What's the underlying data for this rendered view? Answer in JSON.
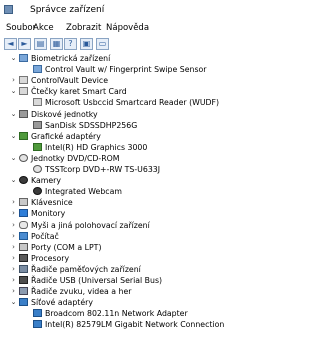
{
  "window": {
    "title": "Správce zařízení"
  },
  "menu": [
    "Soubor",
    "Akce",
    "Zobrazit",
    "Nápověda"
  ],
  "toolbar": [
    {
      "name": "back-button",
      "glyph": "◄"
    },
    {
      "name": "forward-button",
      "glyph": "►"
    },
    {
      "name": "view-tree-button",
      "glyph": "▤"
    },
    {
      "name": "properties-button",
      "glyph": "▦"
    },
    {
      "name": "help-button",
      "glyph": "?"
    },
    {
      "name": "update-driver-button",
      "glyph": "▣"
    },
    {
      "name": "show-display-button",
      "glyph": "▭"
    }
  ],
  "tree": [
    {
      "label": "Biometrická zařízení",
      "level": 0,
      "expanded": true,
      "icon": "dev"
    },
    {
      "label": "Control Vault w/ Fingerprint Swipe Sensor",
      "level": 1,
      "icon": "dev"
    },
    {
      "label": "ControlVault Device",
      "level": 0,
      "expanded": false,
      "icon": "card"
    },
    {
      "label": "Čtečky karet Smart Card",
      "level": 0,
      "expanded": true,
      "icon": "card"
    },
    {
      "label": "Microsoft Usbccid Smartcard Reader (WUDF)",
      "level": 1,
      "icon": "card"
    },
    {
      "label": "Diskové jednotky",
      "level": 0,
      "expanded": true,
      "icon": "disk"
    },
    {
      "label": "SanDisk SDSSDHP256G",
      "level": 1,
      "icon": "disk"
    },
    {
      "label": "Grafické adaptéry",
      "level": 0,
      "expanded": true,
      "icon": "gpu"
    },
    {
      "label": "Intel(R) HD Graphics 3000",
      "level": 1,
      "icon": "gpu"
    },
    {
      "label": "Jednotky DVD/CD-ROM",
      "level": 0,
      "expanded": true,
      "icon": "dvd"
    },
    {
      "label": "TSSTcorp DVD+-RW TS-U633J",
      "level": 1,
      "icon": "dvd"
    },
    {
      "label": "Kamery",
      "level": 0,
      "expanded": true,
      "icon": "cam"
    },
    {
      "label": "Integrated Webcam",
      "level": 1,
      "icon": "cam"
    },
    {
      "label": "Klávesnice",
      "level": 0,
      "expanded": false,
      "icon": "kbd"
    },
    {
      "label": "Monitory",
      "level": 0,
      "expanded": false,
      "icon": "mon"
    },
    {
      "label": "Myši a jiná polohovací zařízení",
      "level": 0,
      "expanded": false,
      "icon": "mouse"
    },
    {
      "label": "Počítač",
      "level": 0,
      "expanded": false,
      "icon": "pc"
    },
    {
      "label": "Porty (COM a LPT)",
      "level": 0,
      "expanded": false,
      "icon": "port"
    },
    {
      "label": "Procesory",
      "level": 0,
      "expanded": false,
      "icon": "cpu"
    },
    {
      "label": "Řadiče paměťových zařízení",
      "level": 0,
      "expanded": false,
      "icon": "ctrl"
    },
    {
      "label": "Řadiče USB (Universal Serial Bus)",
      "level": 0,
      "expanded": false,
      "icon": "usb"
    },
    {
      "label": "Řadiče zvuku, videa a her",
      "level": 0,
      "expanded": false,
      "icon": "snd"
    },
    {
      "label": "Síťové adaptéry",
      "level": 0,
      "expanded": true,
      "icon": "net"
    },
    {
      "label": "Broadcom 802.11n Network Adapter",
      "level": 1,
      "icon": "net"
    },
    {
      "label": "Intel(R) 82579LM Gigabit Network Connection",
      "level": 1,
      "icon": "net"
    }
  ]
}
